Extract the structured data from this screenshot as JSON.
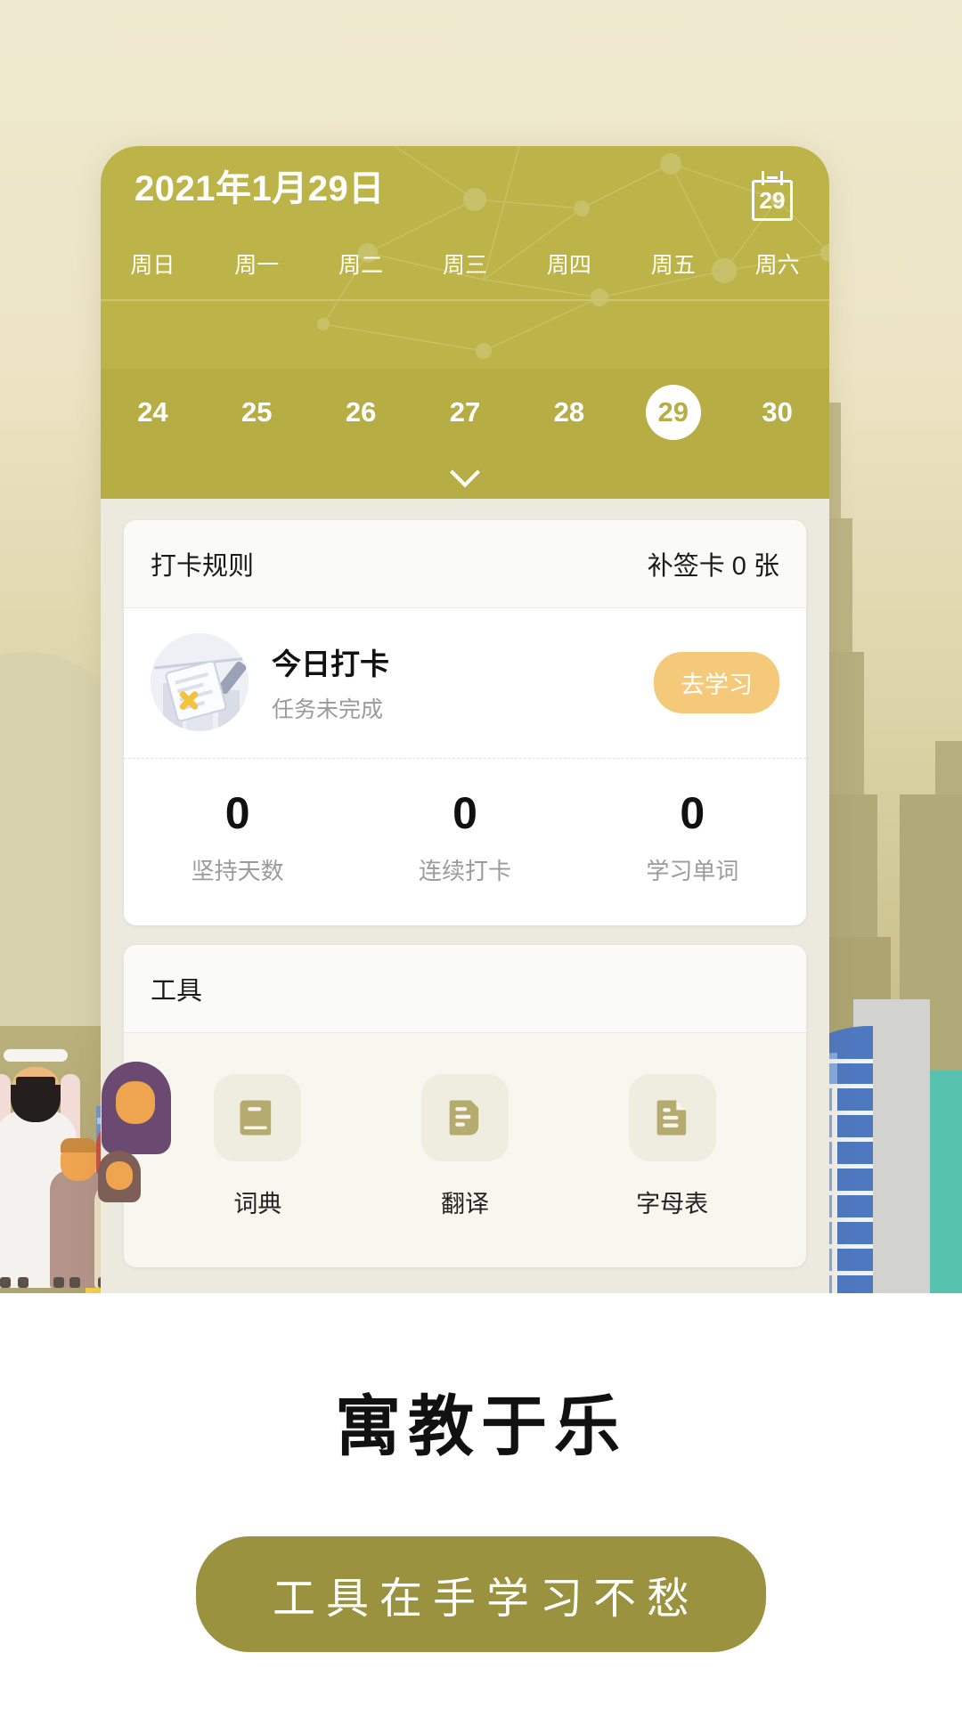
{
  "app": {
    "header": {
      "date_title": "2021年1月29日",
      "calendar_icon_day": "29",
      "weekdays": [
        "周日",
        "周一",
        "周二",
        "周三",
        "周四",
        "周五",
        "周六"
      ],
      "days": [
        "24",
        "25",
        "26",
        "27",
        "28",
        "29",
        "30"
      ],
      "selected_day": "29",
      "expand_icon": "chevron-down-icon",
      "bg_color": "#bcb448",
      "day_strip_color": "#b6ad45"
    },
    "checkin_card": {
      "rules_label": "打卡规则",
      "makeup_card_label": "补签卡 0 张",
      "today_title": "今日打卡",
      "today_status": "任务未完成",
      "action_button": "去学习",
      "action_button_color": "#f5c97a",
      "stats": [
        {
          "value": "0",
          "label": "坚持天数"
        },
        {
          "value": "0",
          "label": "连续打卡"
        },
        {
          "value": "0",
          "label": "学习单词"
        }
      ]
    },
    "tools_card": {
      "title": "工具",
      "items": [
        {
          "label": "词典",
          "icon": "book-icon"
        },
        {
          "label": "翻译",
          "icon": "translate-document-icon"
        },
        {
          "label": "字母表",
          "icon": "document-lines-icon"
        }
      ],
      "icon_color": "#b5ab6e"
    }
  },
  "promo": {
    "headline": "寓教于乐",
    "button_label": "工具在手学习不愁",
    "button_color": "#9b9240"
  }
}
